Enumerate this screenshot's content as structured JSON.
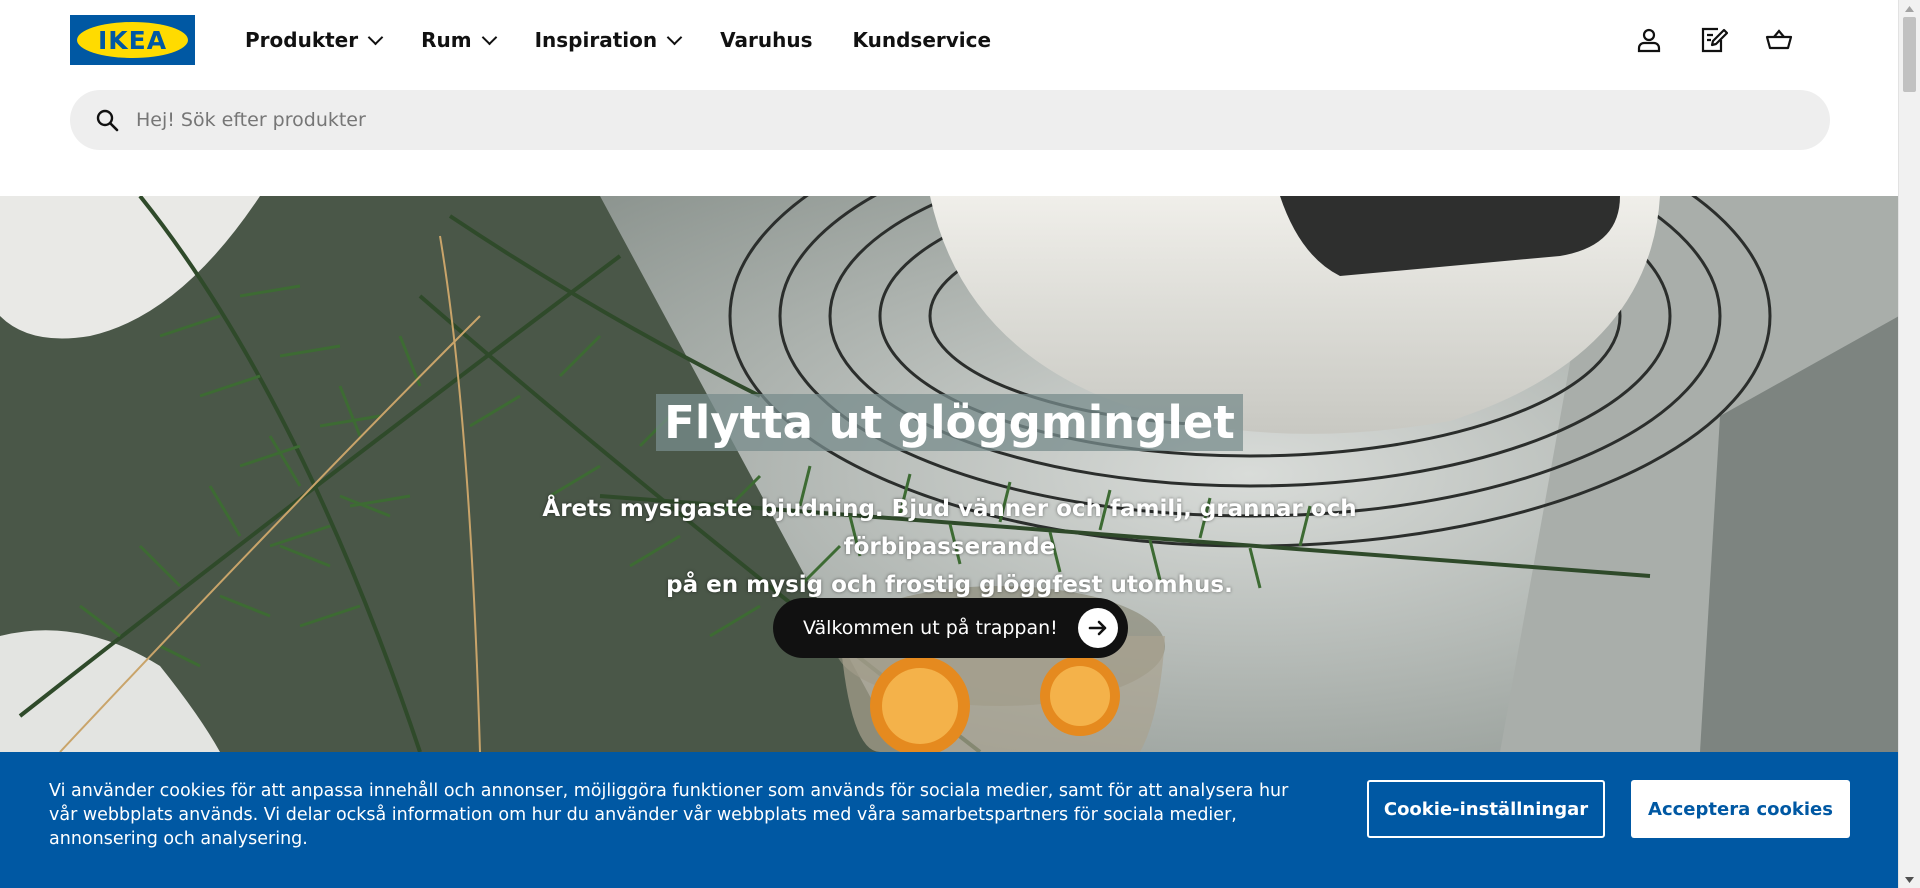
{
  "header": {
    "logo_text": "IKEA",
    "nav": [
      {
        "label": "Produkter",
        "has_dropdown": true
      },
      {
        "label": "Rum",
        "has_dropdown": true
      },
      {
        "label": "Inspiration",
        "has_dropdown": true
      },
      {
        "label": "Varuhus",
        "has_dropdown": false
      },
      {
        "label": "Kundservice",
        "has_dropdown": false
      }
    ],
    "icons": [
      "user-icon",
      "shopping-list-icon",
      "cart-icon"
    ]
  },
  "search": {
    "placeholder": "Hej! Sök efter produkter",
    "value": ""
  },
  "hero": {
    "title": "Flytta ut glöggminglet",
    "subtitle_line1": "Årets mysigaste bjudning. Bjud vänner och familj, grannar och förbipasserande",
    "subtitle_line2": "på en mysig och frostig glöggfest utomhus.",
    "cta_label": "Välkommen ut på trappan!"
  },
  "cookie_banner": {
    "text": "Vi använder cookies för att anpassa innehåll och annonser, möjliggöra funktioner som används för sociala medier, samt för att analysera hur vår webbplats används. Vi delar också information om hur du använder vår webbplats med våra samarbetspartners för sociala medier, annonsering och analysering.",
    "settings_label": "Cookie-inställningar",
    "accept_label": "Acceptera cookies"
  },
  "colors": {
    "brand_blue": "#0058a3",
    "brand_yellow": "#ffdb00",
    "search_bg": "#eeeeee",
    "button_dark": "#111111"
  }
}
